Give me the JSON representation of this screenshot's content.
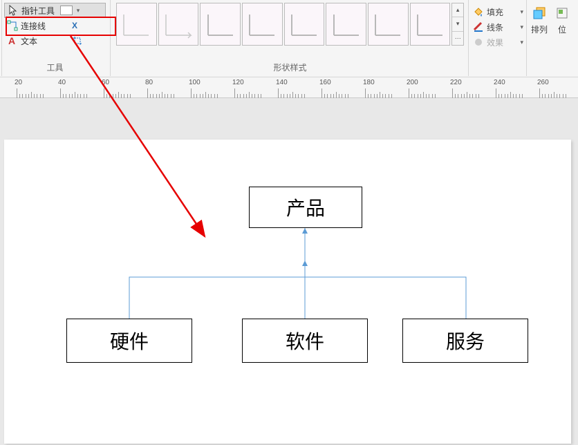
{
  "tools": {
    "pointer_label": "指针工具",
    "connector_label": "连接线",
    "delete_label": "X",
    "text_label": "文本",
    "group_caption": "工具"
  },
  "gallery": {
    "group_caption": "形状样式"
  },
  "format": {
    "fill_label": "填充",
    "line_label": "线条",
    "effect_label": "效果"
  },
  "arrange": {
    "arrange_label": "排列",
    "position_label": "位"
  },
  "ruler": {
    "ticks": [
      "20",
      "40",
      "60",
      "80",
      "100",
      "120",
      "140",
      "160",
      "180",
      "200",
      "220",
      "240",
      "260"
    ]
  },
  "diagram": {
    "root": "产品",
    "c1": "硬件",
    "c2": "软件",
    "c3": "服务"
  }
}
